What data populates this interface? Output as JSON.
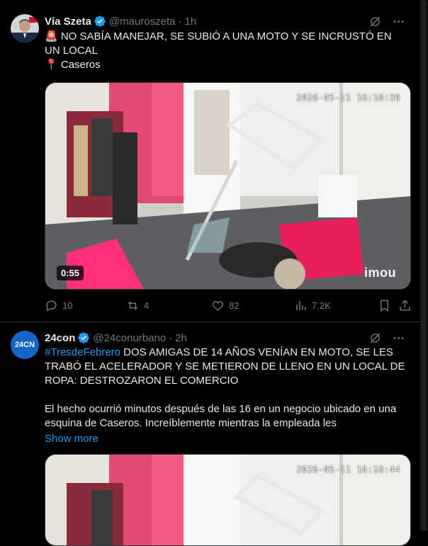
{
  "tweets": [
    {
      "author_name": "Vía Szeta",
      "handle": "@mauroszeta",
      "time": "1h",
      "text_line1": "🚨 NO SABÍA MANEJAR, SE SUBIÓ A UNA MOTO Y SE INCRUSTÓ EN UN LOCAL",
      "text_line2": "📍 Caseros",
      "video_timestamp": "2026-05-11 16:18:39",
      "video_watermark": "imou",
      "video_duration": "0:55",
      "replies": "10",
      "reposts": "4",
      "likes": "82",
      "views": "7.2K"
    },
    {
      "author_name": "24con",
      "avatar_text": "24CN",
      "handle": "@24conurbano",
      "time": "2h",
      "hashtag": "#TresdeFebrero",
      "text_headline": " DOS AMIGAS DE 14 AÑOS VENÍAN EN MOTO, SE LES TRABÓ EL ACELERADOR Y SE METIERON DE LLENO EN UN LOCAL DE ROPA: DESTROZARON EL COMERCIO",
      "text_body": "El hecho ocurrió minutos después de las 16 en un negocio ubicado en una esquina de Caseros. Increíblemente mientras la empleada les",
      "show_more": "Show more",
      "video_timestamp": "2026-05-11 16:18:44"
    }
  ],
  "colors": {
    "accent": "#1d9bf0",
    "background": "#000000",
    "muted": "#71767b",
    "text": "#e7e9ea"
  }
}
